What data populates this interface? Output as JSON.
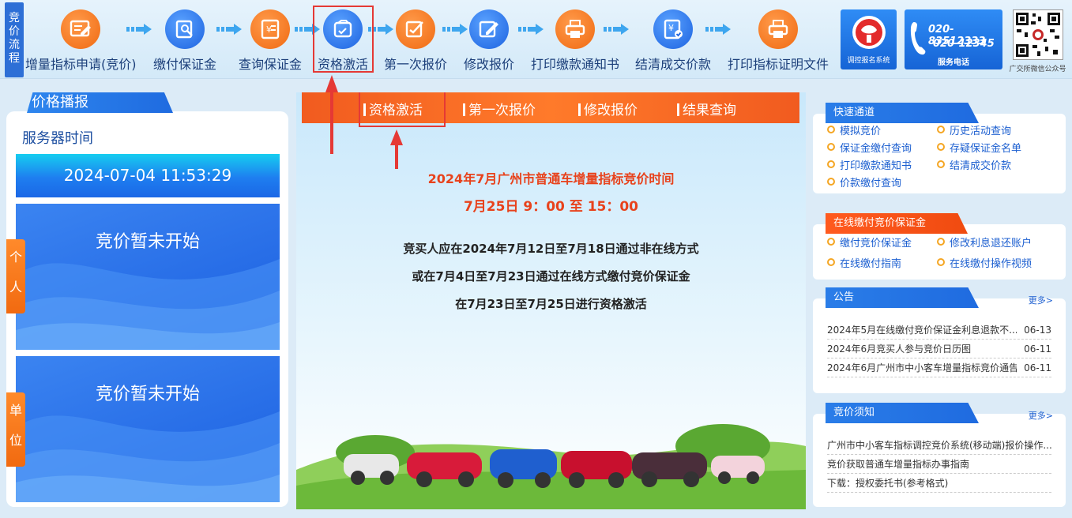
{
  "flow": {
    "tag": "竞价流程"
  },
  "steps": [
    {
      "label": "增量指标申请(竞价)",
      "icon": "form-edit-icon",
      "color": "orange"
    },
    {
      "label": "缴付保证金",
      "icon": "deposit-search-icon",
      "color": "blue"
    },
    {
      "label": "查询保证金",
      "icon": "receipt-yuan-icon",
      "color": "orange"
    },
    {
      "label": "资格激活",
      "icon": "wallet-check-icon",
      "color": "blue"
    },
    {
      "label": "第一次报价",
      "icon": "quote-edit-icon",
      "color": "orange"
    },
    {
      "label": "修改报价",
      "icon": "modify-edit-icon",
      "color": "blue"
    },
    {
      "label": "打印缴款通知书",
      "icon": "printer-icon",
      "color": "orange"
    },
    {
      "label": "结清成交价款",
      "icon": "settle-check-icon",
      "color": "blue"
    },
    {
      "label": "打印指标证明文件",
      "icon": "printer-icon",
      "color": "orange"
    }
  ],
  "header_right": {
    "system_label": "调控报名系统",
    "phone1": "020-83512333",
    "phone2": "020-12345",
    "phone_caption": "服务电话",
    "qr_caption": "广交所微信公众号"
  },
  "left": {
    "title": "价格播报",
    "server_time_label": "服务器时间",
    "server_time": "2024-07-04 11:53:29",
    "personal": {
      "tag": "个人",
      "status": "竞价暂未开始"
    },
    "company": {
      "tag": "单位",
      "status": "竞价暂未开始"
    }
  },
  "center": {
    "tabs": [
      "资格激活",
      "第一次报价",
      "修改报价",
      "结果查询"
    ],
    "notice_title": "2024年7月广州市普通车增量指标竞价时间",
    "notice_time": "7月25日 9：00 至 15：00",
    "lines": [
      "竞买人应在2024年7月12日至7月18日通过非在线方式",
      "或在7月4日至7月23日通过在线方式缴付竞价保证金",
      "在7月23日至7月25日进行资格激活"
    ]
  },
  "right": {
    "quick": {
      "title": "快速通道",
      "links": [
        "模拟竞价",
        "历史活动查询",
        "保证金缴付查询",
        "存疑保证金名单",
        "打印缴款通知书",
        "结清成交价款",
        "价款缴付查询"
      ]
    },
    "online": {
      "title": "在线缴付竞价保证金",
      "links": [
        "缴付竞价保证金",
        "修改利息退还账户",
        "在线缴付指南",
        "在线缴付操作视频"
      ]
    },
    "notice": {
      "title": "公告",
      "more": "更多>",
      "items": [
        {
          "title": "2024年5月在线缴付竞价保证金利息退款不...",
          "date": "06-13"
        },
        {
          "title": "2024年6月竞买人参与竞价日历图",
          "date": "06-11"
        },
        {
          "title": "2024年6月广州市中小客车增量指标竞价通告",
          "date": "06-11"
        }
      ]
    },
    "rules": {
      "title": "竞价须知",
      "more": "更多>",
      "items": [
        "广州市中小客车指标调控竞价系统(移动端)报价操作...",
        "竞价获取普通车增量指标办事指南",
        "下载：授权委托书(参考格式)"
      ]
    }
  },
  "colors": {
    "accent_blue": "#1f6be0",
    "accent_orange": "#f06a12",
    "highlight_red": "#e53935"
  }
}
